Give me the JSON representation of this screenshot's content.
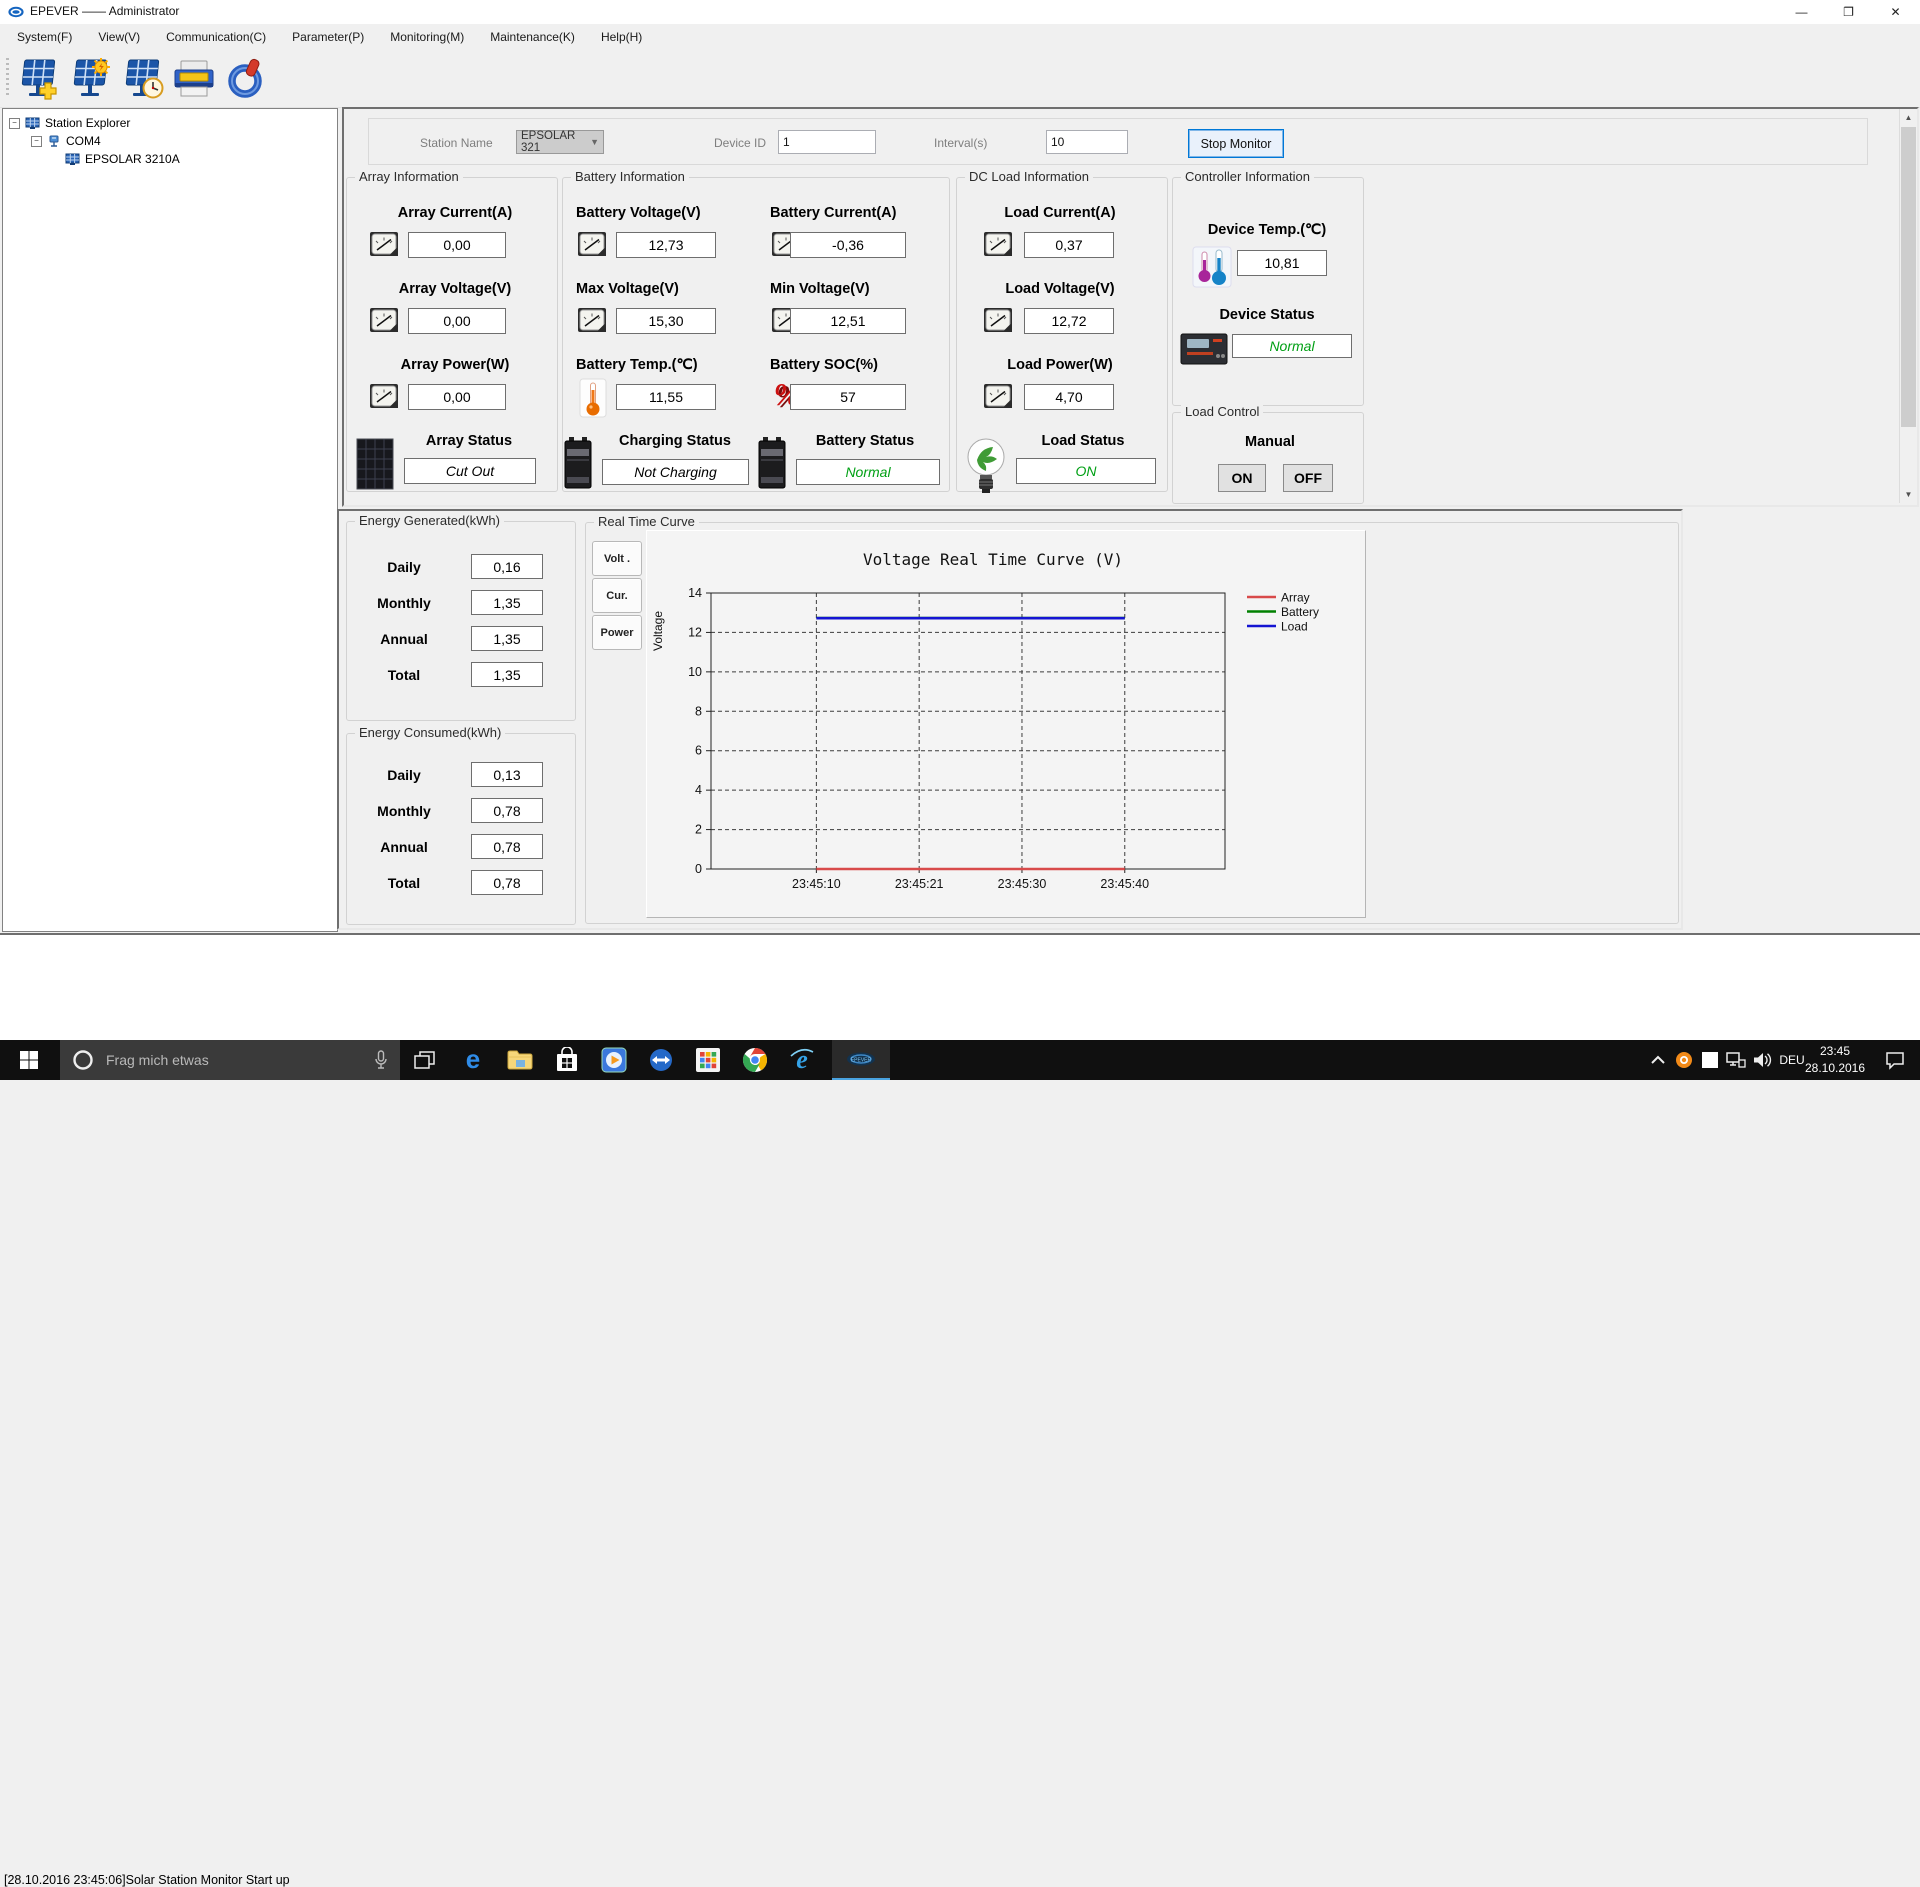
{
  "titlebar": {
    "title": "EPEVER —— Administrator"
  },
  "window_controls": {
    "minimize": "—",
    "restore": "❐",
    "close": "✕"
  },
  "menu": {
    "items": [
      "System(F)",
      "View(V)",
      "Communication(C)",
      "Parameter(P)",
      "Monitoring(M)",
      "Maintenance(K)",
      "Help(H)"
    ]
  },
  "toolbar": {
    "buttons": [
      "add-station",
      "station-monitor",
      "station-history",
      "print",
      "power"
    ]
  },
  "tree": {
    "root": "Station Explorer",
    "port": "COM4",
    "device": "EPSOLAR 3210A"
  },
  "form": {
    "station_name_label": "Station Name",
    "station_name_value": "EPSOLAR 321",
    "device_id_label": "Device ID",
    "device_id_value": "1",
    "interval_label": "Interval(s)",
    "interval_value": "10",
    "stop_button": "Stop Monitor"
  },
  "panels": {
    "array": {
      "title": "Array Information",
      "current_label": "Array Current(A)",
      "current": "0,00",
      "voltage_label": "Array Voltage(V)",
      "voltage": "0,00",
      "power_label": "Array Power(W)",
      "power": "0,00",
      "status_label": "Array Status",
      "status": "Cut Out"
    },
    "battery": {
      "title": "Battery Information",
      "voltage_label": "Battery Voltage(V)",
      "voltage": "12,73",
      "current_label": "Battery Current(A)",
      "current": "-0,36",
      "max_label": "Max Voltage(V)",
      "max": "15,30",
      "min_label": "Min Voltage(V)",
      "min": "12,51",
      "temp_label": "Battery Temp.(℃)",
      "temp": "11,55",
      "soc_label": "Battery SOC(%)",
      "soc": "57",
      "charging_label": "Charging Status",
      "charging": "Not Charging",
      "status_label": "Battery Status",
      "status": "Normal"
    },
    "dcload": {
      "title": "DC Load Information",
      "current_label": "Load Current(A)",
      "current": "0,37",
      "voltage_label": "Load Voltage(V)",
      "voltage": "12,72",
      "power_label": "Load Power(W)",
      "power": "4,70",
      "status_label": "Load Status",
      "status": "ON"
    },
    "controller": {
      "title": "Controller Information",
      "temp_label": "Device Temp.(℃)",
      "temp": "10,81",
      "status_label": "Device Status",
      "status": "Normal"
    },
    "load_control": {
      "title": "Load Control",
      "mode": "Manual",
      "on": "ON",
      "off": "OFF"
    }
  },
  "energy_generated": {
    "title": "Energy Generated(kWh)",
    "rows": [
      {
        "label": "Daily",
        "value": "0,16"
      },
      {
        "label": "Monthly",
        "value": "1,35"
      },
      {
        "label": "Annual",
        "value": "1,35"
      },
      {
        "label": "Total",
        "value": "1,35"
      }
    ]
  },
  "energy_consumed": {
    "title": "Energy Consumed(kWh)",
    "rows": [
      {
        "label": "Daily",
        "value": "0,13"
      },
      {
        "label": "Monthly",
        "value": "0,78"
      },
      {
        "label": "Annual",
        "value": "0,78"
      },
      {
        "label": "Total",
        "value": "0,78"
      }
    ]
  },
  "curve": {
    "group_title": "Real Time Curve",
    "tabs": [
      "Volt .",
      "Cur.",
      "Power"
    ]
  },
  "chart_data": {
    "type": "line",
    "title": "Voltage Real Time Curve (V)",
    "ylabel": "Voltage",
    "ylim": [
      0,
      14
    ],
    "ytick_step": 2,
    "grid": true,
    "legend_position": "right",
    "x_ticks": [
      "23:45:10",
      "23:45:21",
      "23:45:30",
      "23:45:40"
    ],
    "series": [
      {
        "name": "Array",
        "color": "#d84a4a",
        "values": [
          0,
          0,
          0,
          0
        ]
      },
      {
        "name": "Battery",
        "color": "#008000",
        "values": [
          12.73,
          12.73,
          12.73,
          12.73
        ]
      },
      {
        "name": "Load",
        "color": "#1414d2",
        "values": [
          12.72,
          12.72,
          12.72,
          12.72
        ]
      }
    ]
  },
  "statusbar": {
    "log": "[28.10.2016 23:45:06]Solar Station Monitor Start up"
  },
  "taskbar": {
    "search_placeholder": "Frag mich etwas",
    "language": "DEU",
    "time": "23:45",
    "date": "28.10.2016"
  },
  "icons": [
    "epever-logo-icon",
    "solar-panel-icon",
    "com-port-icon",
    "meter-icon",
    "thermometer-icon",
    "dual-thermometer-icon",
    "percent-icon",
    "battery-icon",
    "solar-panel-dark-icon",
    "bulb-icon",
    "controller-device-icon",
    "printer-icon",
    "power-icon",
    "windows-logo-icon",
    "cortana-icon",
    "microphone-icon",
    "task-view-icon",
    "edge-icon",
    "file-explorer-icon",
    "store-icon",
    "media-player-icon",
    "teamviewer-icon",
    "app-grid-icon",
    "chrome-icon",
    "ie-icon",
    "chevron-up-icon",
    "network-icon",
    "speaker-icon",
    "action-center-icon"
  ]
}
